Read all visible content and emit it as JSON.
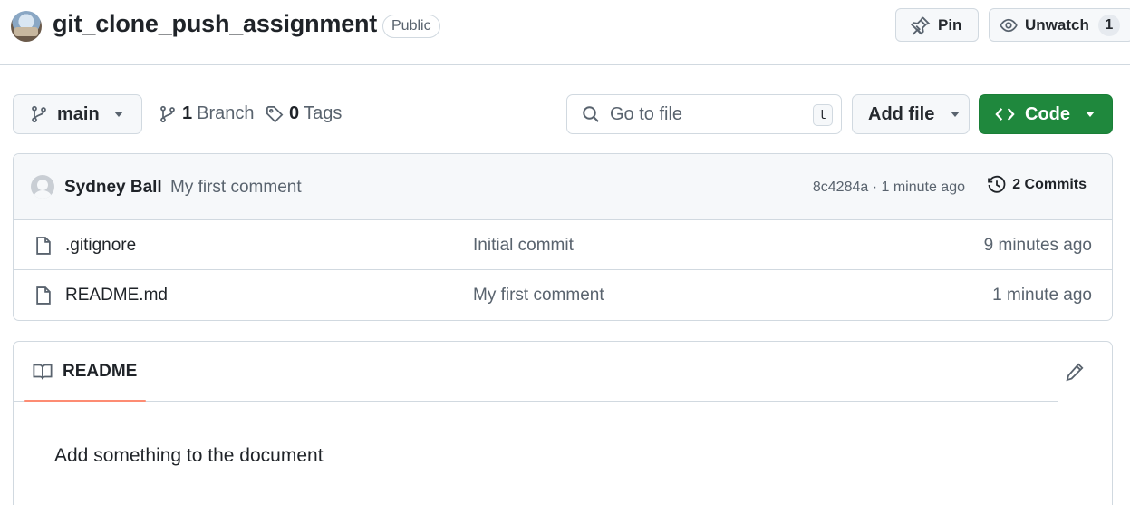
{
  "header": {
    "repo_name": "git_clone_push_assignment",
    "visibility": "Public",
    "pin_label": "Pin",
    "unwatch_label": "Unwatch",
    "watch_count": "1"
  },
  "toolbar": {
    "branch": "main",
    "branch_count": "1",
    "branch_word": "Branch",
    "tag_count": "0",
    "tag_word": "Tags",
    "goto_placeholder": "Go to file",
    "goto_shortcut": "t",
    "add_file_label": "Add file",
    "code_label": "Code"
  },
  "latest_commit": {
    "author": "Sydney Ball",
    "message": "My first comment",
    "meta": "8c4284a · 1 minute ago",
    "commits_label": "2 Commits"
  },
  "files": [
    {
      "name": ".gitignore",
      "message": "Initial commit",
      "time": "9 minutes ago"
    },
    {
      "name": "README.md",
      "message": "My first comment",
      "time": "1 minute ago"
    }
  ],
  "readme": {
    "tab_label": "README",
    "content": "Add something to the document"
  },
  "colors": {
    "accent_green": "#1f883d",
    "tab_underline": "#fd8c73",
    "border": "#d1d9e0"
  }
}
